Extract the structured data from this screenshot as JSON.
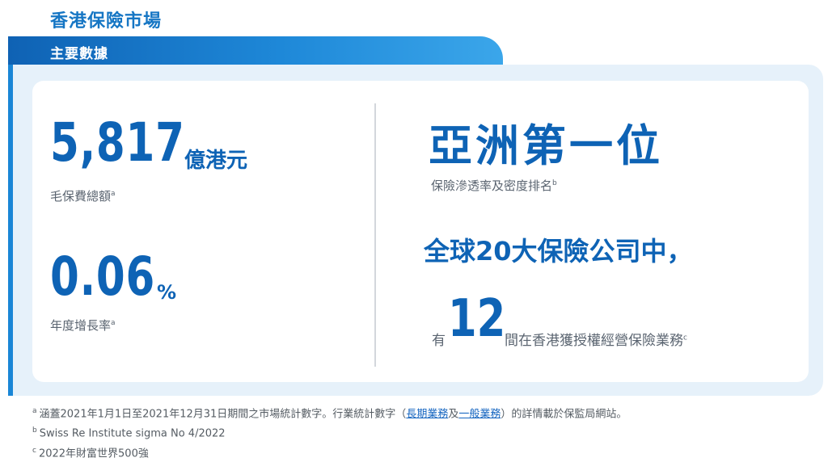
{
  "page_title": "香港保險市場",
  "tab_label": "主要數據",
  "premium": {
    "value": "5,817",
    "unit": "億港元",
    "caption": "毛保費總額",
    "note": "a"
  },
  "growth": {
    "value": "0.06",
    "unit": "%",
    "caption": "年度增長率",
    "note": "a"
  },
  "ranking": {
    "title": "亞洲第一位",
    "caption": "保險滲透率及密度排名",
    "note": "b"
  },
  "global": {
    "title": "全球20大保險公司中，",
    "prefix": "有",
    "count": "12",
    "suffix": "間在香港獲授權經營保險業務",
    "note": "c"
  },
  "footnotes": {
    "a_mark": "a",
    "a_text_1": "涵蓋2021年1月1日至2021年12月31日期間之市場統計數字。行業統計數字（",
    "a_link_long": "長期業務",
    "a_text_and": "及",
    "a_link_general": "一般業務",
    "a_text_2": "）的詳情載於保監局網站。",
    "b_mark": "b",
    "b_text": "Swiss Re Institute sigma No 4/2022",
    "c_mark": "c",
    "c_text": "2022年財富世界500強"
  }
}
